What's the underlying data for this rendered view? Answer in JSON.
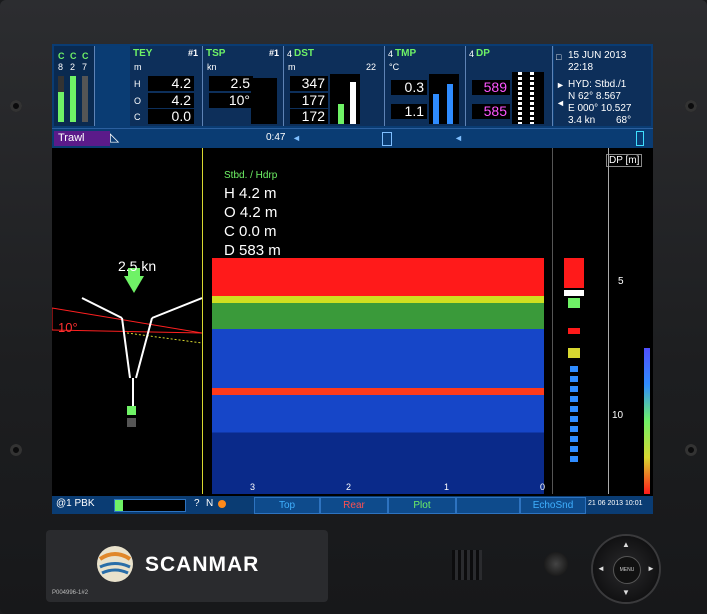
{
  "top": {
    "channels": [
      "C",
      "C",
      "C"
    ],
    "channel_nums": [
      "8",
      "2",
      "7"
    ],
    "tey": {
      "title": "TEY",
      "num": "#1",
      "unit": "m",
      "labels": [
        "H",
        "O",
        "C"
      ],
      "values": [
        "4.2",
        "4.2",
        "0.0"
      ]
    },
    "tsp": {
      "title": "TSP",
      "num": "#1",
      "unit": "kn",
      "values": [
        "2.5",
        "10°"
      ]
    },
    "dst": {
      "title": "DST",
      "index": "4",
      "unit": "m",
      "values": [
        "347",
        "177",
        "172"
      ],
      "scale": "22"
    },
    "tmp": {
      "title": "TMP",
      "index": "4",
      "unit": "°C",
      "values": [
        "0.3",
        "1.1"
      ]
    },
    "dp": {
      "title": "DP",
      "index": "4",
      "values": [
        "589",
        "585"
      ]
    },
    "info": {
      "date": "15 JUN 2013",
      "time": "22:18",
      "hyd": "HYD: Stbd./1",
      "lat": "N  62° 8.567",
      "lon": "E 000° 10.527",
      "speed": "3.4 kn",
      "heading": "68°"
    }
  },
  "nav": {
    "mode": "Trawl",
    "time": "0:47"
  },
  "trawl": {
    "speed": "2.5 kn",
    "angle": "10°"
  },
  "echo": {
    "sensor": "Stbd. / Hdrp",
    "readings": [
      {
        "k": "H",
        "v": "4.2 m"
      },
      {
        "k": "O",
        "v": "4.2 m"
      },
      {
        "k": "C",
        "v": "0.0 m"
      },
      {
        "k": "D",
        "v": "583 m"
      }
    ],
    "xticks": [
      "3",
      "2",
      "1",
      "0"
    ]
  },
  "depth": {
    "title": "DP [m]",
    "ticks": [
      "5",
      "10"
    ]
  },
  "bottom": {
    "left": "@1 PBK",
    "mid1": "?",
    "mid2": "N",
    "buttons": [
      "Top",
      "Rear",
      "Plot",
      "",
      "EchoSnd"
    ],
    "right": "21 06 2013 10:01"
  },
  "brand": "SCANMAR",
  "code": "P004996-1#2",
  "colors": {
    "green": "#6ff266",
    "red": "#ff2020",
    "bar": "#0a3c73",
    "magenta": "#ff55ff"
  }
}
